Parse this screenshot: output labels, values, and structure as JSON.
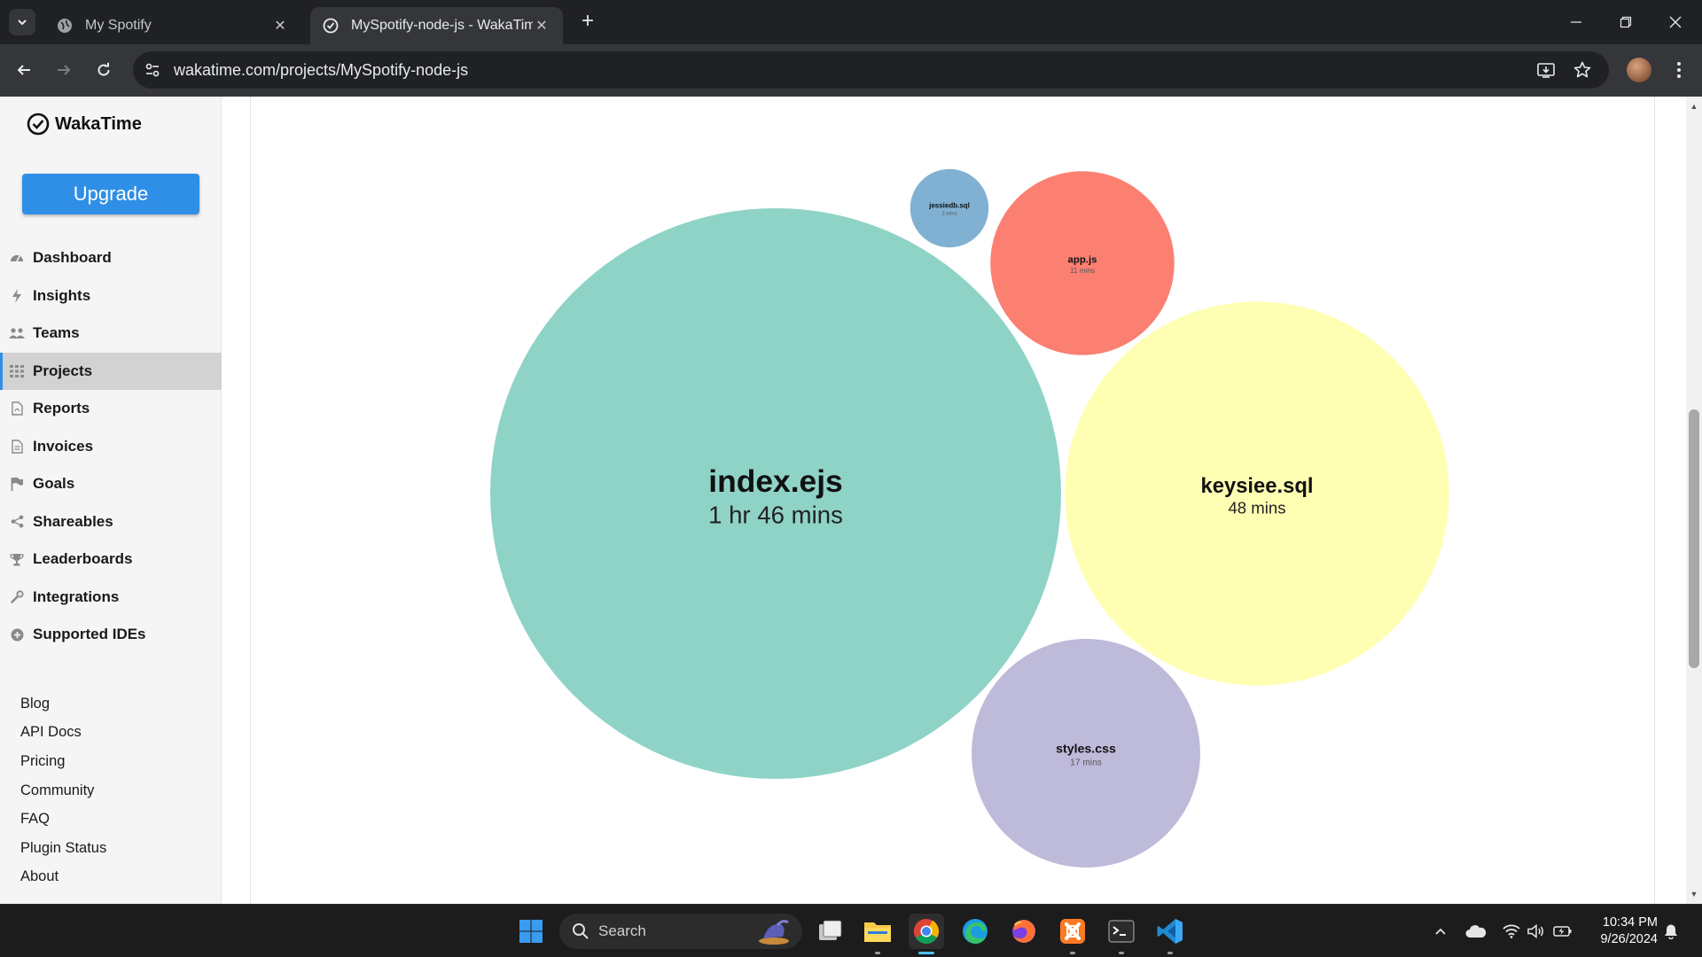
{
  "browser": {
    "tabs": [
      {
        "title": "My Spotify",
        "active": false
      },
      {
        "title": "MySpotify-node-js - WakaTime",
        "active": true
      }
    ],
    "url": "wakatime.com/projects/MySpotify-node-js"
  },
  "sidebar": {
    "brand": "WakaTime",
    "upgrade_label": "Upgrade",
    "nav": [
      {
        "label": "Dashboard",
        "icon": "dashboard-icon"
      },
      {
        "label": "Insights",
        "icon": "bolt-icon"
      },
      {
        "label": "Teams",
        "icon": "users-icon"
      },
      {
        "label": "Projects",
        "icon": "grid-icon",
        "selected": true
      },
      {
        "label": "Reports",
        "icon": "pdf-file-icon"
      },
      {
        "label": "Invoices",
        "icon": "file-icon"
      },
      {
        "label": "Goals",
        "icon": "flag-icon"
      },
      {
        "label": "Shareables",
        "icon": "share-icon"
      },
      {
        "label": "Leaderboards",
        "icon": "trophy-icon"
      },
      {
        "label": "Integrations",
        "icon": "wrench-icon"
      },
      {
        "label": "Supported IDEs",
        "icon": "plus-circle-icon"
      }
    ],
    "links": [
      "Blog",
      "API Docs",
      "Pricing",
      "Community",
      "FAQ",
      "Plugin Status",
      "About"
    ]
  },
  "chart_data": {
    "type": "bubble",
    "title": "",
    "items": [
      {
        "name": "index.ejs",
        "label": "1 hr 46 mins",
        "minutes": 106,
        "color": "#8fd3c7"
      },
      {
        "name": "keysiee.sql",
        "label": "48 mins",
        "minutes": 48,
        "color": "#ffffb3"
      },
      {
        "name": "styles.css",
        "label": "17 mins",
        "minutes": 17,
        "color": "#bebada"
      },
      {
        "name": "app.js",
        "label": "11 mins",
        "minutes": 11,
        "color": "#fb8072"
      },
      {
        "name": "jessiedb.sql",
        "label": "2 mins",
        "minutes": 2,
        "color": "#80b1d3"
      }
    ]
  },
  "taskbar": {
    "search_placeholder": "Search",
    "time": "10:34 PM",
    "date": "9/26/2024"
  }
}
